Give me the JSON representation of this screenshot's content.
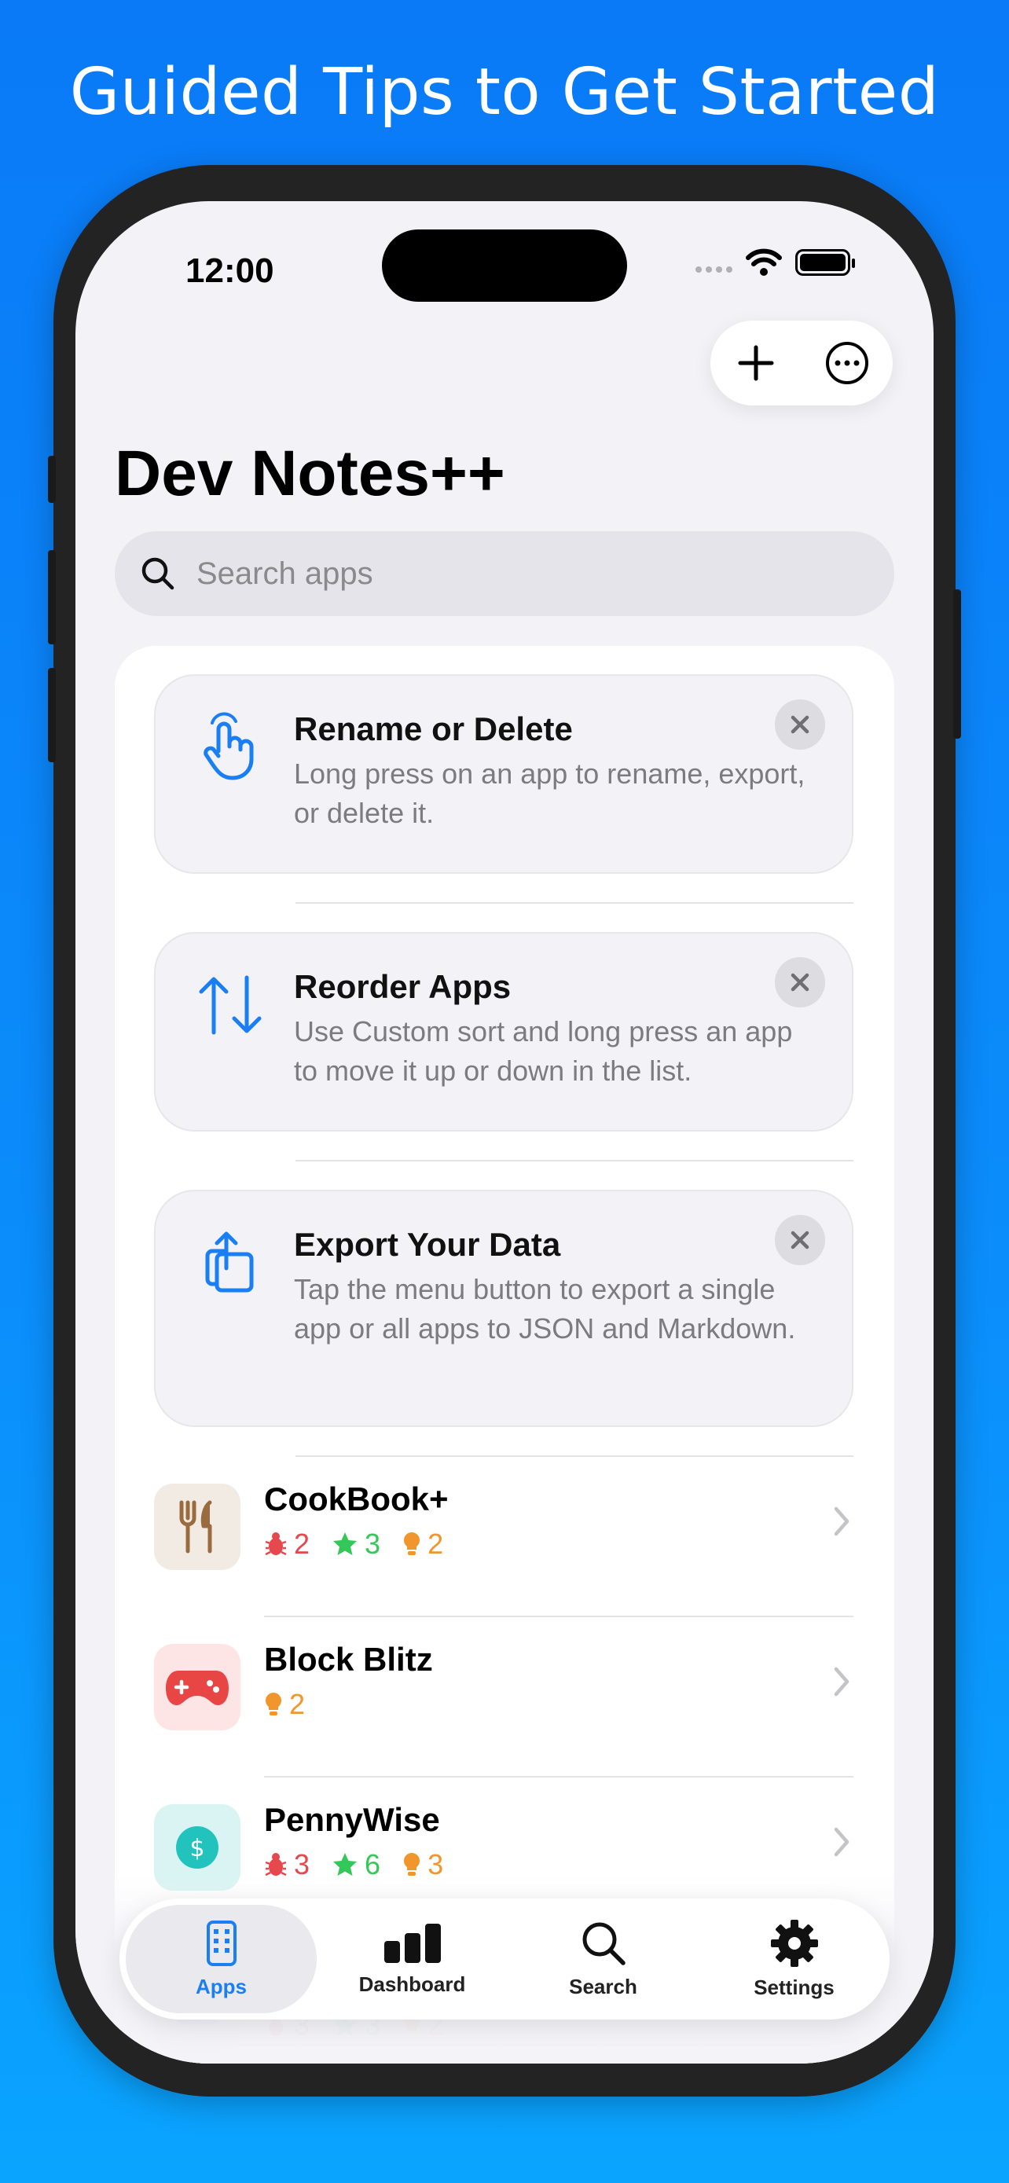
{
  "headline": "Guided Tips to Get Started",
  "status": {
    "time": "12:00"
  },
  "app": {
    "title": "Dev Notes++"
  },
  "search": {
    "placeholder": "Search apps"
  },
  "tips": [
    {
      "icon": "hand-tap-icon",
      "title": "Rename or Delete",
      "body": "Long press on an app to rename, export, or delete it."
    },
    {
      "icon": "arrows-up-down-icon",
      "title": "Reorder Apps",
      "body": "Use Custom sort and long press an app to move it up or down in the list."
    },
    {
      "icon": "export-icon",
      "title": "Export Your Data",
      "body": "Tap the menu button to export a single app or all apps to JSON and Markdown."
    }
  ],
  "apps": [
    {
      "name": "CookBook+",
      "icon": "fork-knife-icon",
      "bugs": "2",
      "features": "3",
      "ideas": "2"
    },
    {
      "name": "Block Blitz",
      "icon": "gamepad-icon",
      "ideas": "2"
    },
    {
      "name": "PennyWise",
      "icon": "dollar-icon",
      "bugs": "3",
      "features": "6",
      "ideas": "3"
    },
    {
      "name": "",
      "icon": "camera-icon",
      "bugs": "3",
      "features": "3",
      "ideas": "2"
    }
  ],
  "tabs": [
    {
      "label": "Apps",
      "icon": "phone-icon",
      "active": true
    },
    {
      "label": "Dashboard",
      "icon": "bar-chart-icon"
    },
    {
      "label": "Search",
      "icon": "search-icon"
    },
    {
      "label": "Settings",
      "icon": "gear-icon"
    }
  ],
  "colors": {
    "accent": "#1a7ef5",
    "bug": "#e5484d",
    "feature": "#34c759",
    "idea": "#f0962d"
  }
}
